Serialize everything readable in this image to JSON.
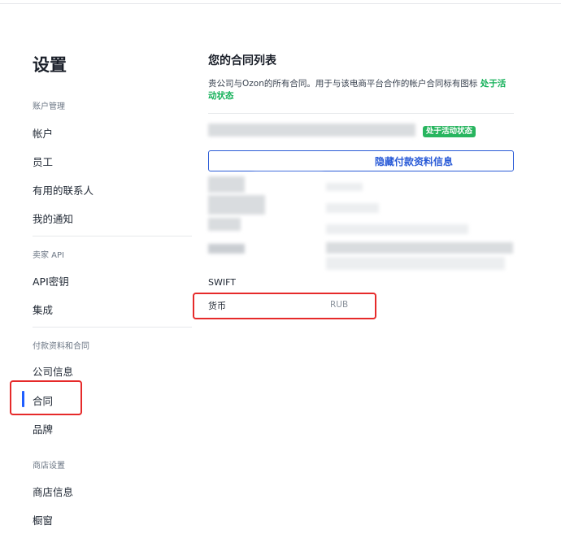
{
  "sidebar": {
    "title": "设置",
    "sections": [
      {
        "label": "账户管理",
        "items": [
          "帐户",
          "员工",
          "有用的联系人",
          "我的通知"
        ]
      },
      {
        "label": "卖家 API",
        "items": [
          "API密钥",
          "集成"
        ]
      },
      {
        "label": "付款资料和合同",
        "items": [
          "公司信息",
          "合同",
          "品牌"
        ]
      },
      {
        "label": "商店设置",
        "items": [
          "商店信息",
          "橱窗"
        ]
      }
    ],
    "active_item": "合同"
  },
  "main": {
    "title": "您的合同列表",
    "description": "贵公司与Ozon的所有合同。用于与该电商平台合作的帐户合同标有图标",
    "status_link": "处于活动状态",
    "contract_status_badge": "处于活动状态",
    "payment_button_label": "隐藏付款资料信息",
    "details": [
      {
        "label": "SWIFT",
        "value": ""
      },
      {
        "label": "货币",
        "value": "RUB"
      }
    ]
  },
  "colors": {
    "accent_blue": "#2a5bd7",
    "active_indicator": "#1f5eff",
    "status_green": "#28b55f",
    "highlight_red": "#e62a2a"
  }
}
